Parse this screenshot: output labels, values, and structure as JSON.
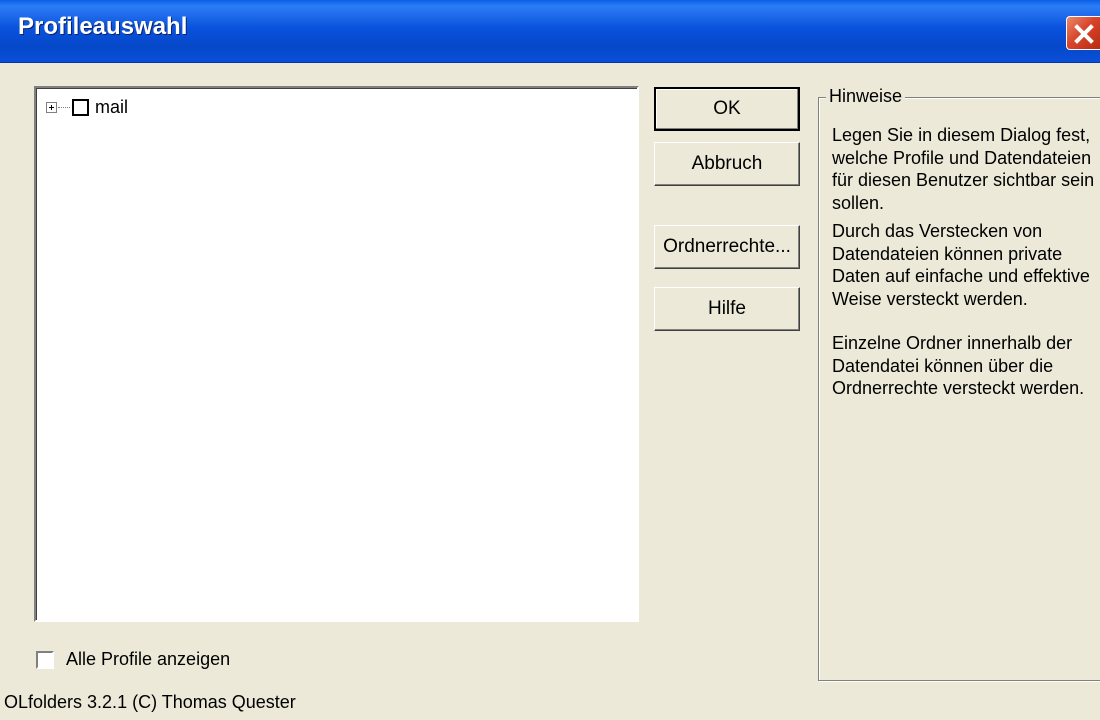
{
  "window": {
    "title": "Profileauswahl",
    "close_icon": "close-icon"
  },
  "tree": {
    "items": [
      {
        "label": "mail",
        "expanded": false,
        "checked": false
      }
    ]
  },
  "buttons": {
    "ok": "OK",
    "cancel": "Abbruch",
    "folder_rights": "Ordnerrechte...",
    "help": "Hilfe"
  },
  "hints": {
    "title": "Hinweise",
    "paragraph1": "Legen Sie in diesem Dialog fest, welche Profile und Datendateien für diesen Benutzer sichtbar sein sollen.",
    "paragraph2": "Durch das Verstecken von Datendateien können private Daten auf einfache und effektive Weise versteckt werden.",
    "paragraph3": "Einzelne Ordner innerhalb der Datendatei können über die Ordnerrechte versteckt werden."
  },
  "show_all_profiles": {
    "label": "Alle Profile anzeigen",
    "checked": false
  },
  "footer": "OLfolders 3.2.1 (C) Thomas Quester",
  "colors": {
    "titlebar": "#0a52dd",
    "dialog_bg": "#ece9d8",
    "close_button": "#d8462a"
  }
}
